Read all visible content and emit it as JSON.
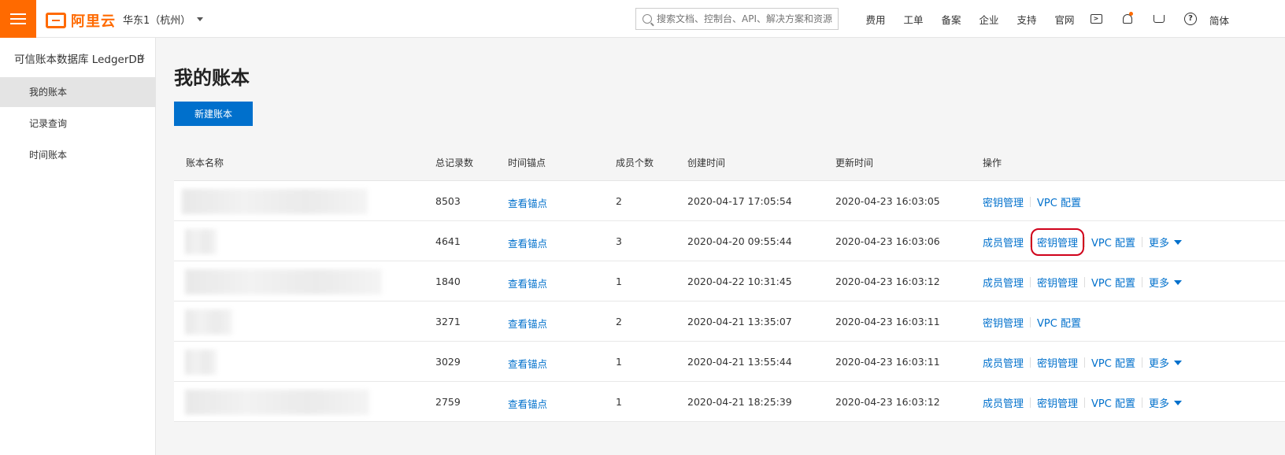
{
  "header": {
    "logo_text": "阿里云",
    "region": "华东1（杭州）",
    "search_placeholder": "搜索文档、控制台、API、解决方案和资源",
    "links": [
      "费用",
      "工单",
      "备案",
      "企业",
      "支持",
      "官网"
    ],
    "lang": "简体",
    "accent_color": "#ff6a00"
  },
  "sidebar": {
    "title": "可信账本数据库 LedgerDB",
    "items": [
      {
        "label": "我的账本",
        "active": true
      },
      {
        "label": "记录查询",
        "active": false
      },
      {
        "label": "时间账本",
        "active": false
      }
    ]
  },
  "main": {
    "title": "我的账本",
    "new_button": "新建账本",
    "columns": {
      "name": "账本名称",
      "records": "总记录数",
      "anchor": "时间锚点",
      "members": "成员个数",
      "created": "创建时间",
      "updated": "更新时间",
      "ops": "操作"
    },
    "anchor_link": "查看锚点",
    "op_labels": {
      "members": "成员管理",
      "keys": "密钥管理",
      "vpc": "VPC 配置",
      "more": "更多"
    },
    "rows": [
      {
        "records": "8503",
        "members": "2",
        "created": "2020-04-17 17:05:54",
        "updated": "2020-04-23 16:03:05"
      },
      {
        "records": "4641",
        "members": "3",
        "created": "2020-04-20 09:55:44",
        "updated": "2020-04-23 16:03:06"
      },
      {
        "records": "1840",
        "members": "1",
        "created": "2020-04-22 10:31:45",
        "updated": "2020-04-23 16:03:12"
      },
      {
        "records": "3271",
        "members": "2",
        "created": "2020-04-21 13:35:07",
        "updated": "2020-04-23 16:03:11"
      },
      {
        "records": "3029",
        "members": "1",
        "created": "2020-04-21 13:55:44",
        "updated": "2020-04-23 16:03:11"
      },
      {
        "records": "2759",
        "members": "1",
        "created": "2020-04-21 18:25:39",
        "updated": "2020-04-23 16:03:12"
      }
    ]
  }
}
